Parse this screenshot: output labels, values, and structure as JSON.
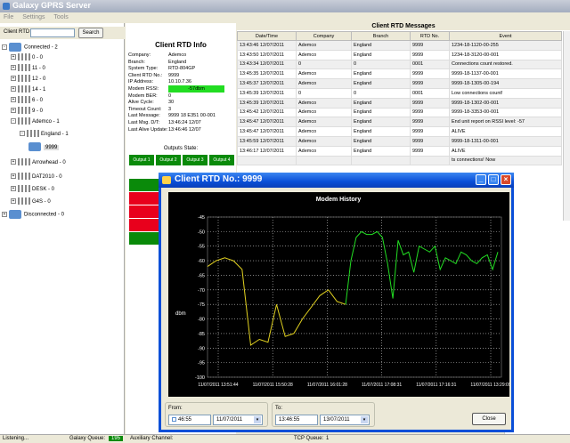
{
  "app": {
    "title": "Galaxy GPRS Server",
    "menu": [
      "File",
      "Settings",
      "Tools"
    ]
  },
  "search": {
    "label": "Client RTD No.:",
    "value": "",
    "button": "Search"
  },
  "tree": [
    {
      "label": "Connected - 2",
      "level": 0,
      "kind": "net",
      "pm": "-"
    },
    {
      "label": "0 - 0",
      "level": 1,
      "kind": "bars",
      "pm": "+"
    },
    {
      "label": "11 - 0",
      "level": 1,
      "kind": "bars",
      "pm": "+"
    },
    {
      "label": "12 - 0",
      "level": 1,
      "kind": "bars",
      "pm": "+"
    },
    {
      "label": "14 - 1",
      "level": 1,
      "kind": "bars",
      "pm": "+"
    },
    {
      "label": "6 - 0",
      "level": 1,
      "kind": "bars",
      "pm": "+"
    },
    {
      "label": "9 - 0",
      "level": 1,
      "kind": "bars",
      "pm": "+"
    },
    {
      "label": "Ademco - 1",
      "level": 1,
      "kind": "bars",
      "pm": "-"
    },
    {
      "label": "England - 1",
      "level": 2,
      "kind": "bars",
      "pm": "-"
    },
    {
      "label": "9999",
      "level": 3,
      "kind": "net",
      "pm": "",
      "selected": true
    },
    {
      "label": "Arrowhead - 0",
      "level": 1,
      "kind": "bars",
      "pm": "+"
    },
    {
      "label": "DAT2010 - 0",
      "level": 1,
      "kind": "bars",
      "pm": "+"
    },
    {
      "label": "DESK - 0",
      "level": 1,
      "kind": "bars",
      "pm": "+"
    },
    {
      "label": "G4S - 0",
      "level": 1,
      "kind": "bars",
      "pm": "+"
    },
    {
      "label": "Disconnected - 0",
      "level": 0,
      "kind": "net",
      "pm": "+"
    }
  ],
  "info": {
    "title": "Client RTD Info",
    "rows": [
      {
        "k": "Company:",
        "v": "Ademco"
      },
      {
        "k": "Branch:",
        "v": "England"
      },
      {
        "k": "System Type:",
        "v": "RTD-804GP"
      },
      {
        "k": "Client RTD No.:",
        "v": "9999"
      },
      {
        "k": "IP Address:",
        "v": "10.10.7.36"
      },
      {
        "k": "Modem RSSI:",
        "v": "-57dbm",
        "highlight": true
      },
      {
        "k": "Modem BER:",
        "v": "0"
      },
      {
        "k": "Alive Cycle:",
        "v": "30"
      },
      {
        "k": "Timeout Count:",
        "v": "3"
      },
      {
        "k": "Last Message:",
        "v": "9999 18 E351 00-001"
      },
      {
        "k": "Last Msg. D/T:",
        "v": "13:46:24 12/07"
      },
      {
        "k": "Last Alive Update:",
        "v": "13:46:46 12/07"
      }
    ],
    "outputs_title": "Outputs State:",
    "outputs": [
      "Output 1",
      "Output 2",
      "Output 3",
      "Output 4"
    ],
    "state_colors": [
      "#0a8a0a",
      "#e8001c",
      "#e8001c",
      "#e8001c",
      "#0a8a0a"
    ]
  },
  "messages": {
    "title": "Client RTD Messages",
    "columns": [
      "Date/Time",
      "Company",
      "Branch",
      "RTD No.",
      "Event"
    ],
    "rows": [
      [
        "13:43:46 12/07/2011",
        "Ademco",
        "England",
        "9999",
        "1234-18-1120-00-255"
      ],
      [
        "13:43:50 12/07/2011",
        "Ademco",
        "England",
        "9999",
        "1234-18-3120-00-001"
      ],
      [
        "13:43:34 12/07/2011",
        "0",
        "0",
        "0001",
        "Connections count restored."
      ],
      [
        "13:45:35 12/07/2011",
        "Ademco",
        "England",
        "9999",
        "9999-18-1137-00-001"
      ],
      [
        "13:45:37 12/07/2011",
        "Ademco",
        "England",
        "9999",
        "9999-18-1305-00-194"
      ],
      [
        "13:45:39 12/07/2011",
        "0",
        "0",
        "0001",
        "Low connections count!"
      ],
      [
        "13:45:39 12/07/2011",
        "Ademco",
        "England",
        "9999",
        "9999-18-1302-00-001"
      ],
      [
        "13:45:42 12/07/2011",
        "Ademco",
        "England",
        "9999",
        "9999-18-3353-00-001"
      ],
      [
        "13:45:47 12/07/2011",
        "Ademco",
        "England",
        "9999",
        "End unit report on RSSI level: -57"
      ],
      [
        "13:45:47 12/07/2011",
        "Ademco",
        "England",
        "9999",
        "ALIVE"
      ],
      [
        "13:45:59 12/07/2011",
        "Ademco",
        "England",
        "9999",
        "9999-18-1311-00-001"
      ],
      [
        "13:46:17 12/07/2011",
        "Ademco",
        "England",
        "9999",
        "ALIVE"
      ],
      [
        "",
        "",
        "",
        "",
        "ts connections! Now"
      ]
    ]
  },
  "status": {
    "listening": "Listening...",
    "queue_label": "Galaxy Queue:",
    "queue_value": "195",
    "aux": "Auxiliary Channel:",
    "tcp": "TCP Queue:",
    "tcp_value": "1"
  },
  "dialog": {
    "title": "Client RTD No.: 9999",
    "from_label": "From:",
    "from_time": "46:55",
    "from_date": "11/07/2011",
    "to_label": "To:",
    "to_time": "13:46:55",
    "to_date": "13/07/2011",
    "close": "Close",
    "min_glyph": "_",
    "max_glyph": "□",
    "close_glyph": "×",
    "dropdown_glyph": "▾"
  },
  "chart_data": {
    "type": "line",
    "title": "Modem History",
    "ylabel": "dbm",
    "xlabel": "",
    "ylim": [
      -100,
      -45
    ],
    "yticks": [
      -45,
      -50,
      -55,
      -60,
      -65,
      -70,
      -75,
      -80,
      -85,
      -90,
      -95,
      -100
    ],
    "xtick_labels": [
      "11/07/2011 13:51:44",
      "11/07/2011 15:50:28",
      "11/07/2011 16:01:28",
      "11/07/2011 17:08:31",
      "11/07/2011 17:16:31",
      "11/07/2011 13:29:09"
    ],
    "grid": true,
    "series": [
      {
        "color": "#e0d020",
        "points": [
          -62,
          -60,
          -59,
          -60,
          -63,
          -89,
          -87,
          -88,
          -75,
          -86,
          -85,
          -80,
          -76,
          -72,
          -70,
          -74,
          -75
        ]
      },
      {
        "color": "#22dd22",
        "points": [
          -75,
          -60,
          -52,
          -50,
          -51,
          -51,
          -50,
          -52,
          -61,
          -73,
          -53,
          -58,
          -57,
          -64,
          -55,
          -56,
          -57,
          -55,
          -63,
          -59,
          -60,
          -61,
          -57,
          -58,
          -60,
          -61,
          -59,
          -58,
          -63,
          -57
        ]
      }
    ]
  }
}
